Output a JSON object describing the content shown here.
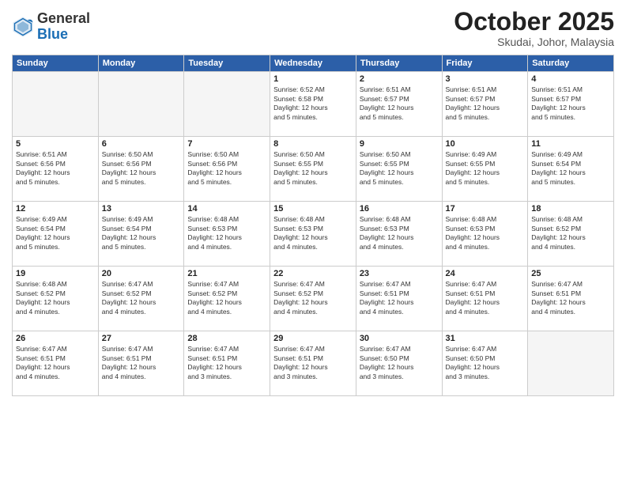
{
  "header": {
    "logo": {
      "general": "General",
      "blue": "Blue"
    },
    "title": "October 2025",
    "subtitle": "Skudai, Johor, Malaysia"
  },
  "calendar": {
    "weekdays": [
      "Sunday",
      "Monday",
      "Tuesday",
      "Wednesday",
      "Thursday",
      "Friday",
      "Saturday"
    ],
    "weeks": [
      [
        {
          "day": "",
          "details": ""
        },
        {
          "day": "",
          "details": ""
        },
        {
          "day": "",
          "details": ""
        },
        {
          "day": "1",
          "details": "Sunrise: 6:52 AM\nSunset: 6:58 PM\nDaylight: 12 hours\nand 5 minutes."
        },
        {
          "day": "2",
          "details": "Sunrise: 6:51 AM\nSunset: 6:57 PM\nDaylight: 12 hours\nand 5 minutes."
        },
        {
          "day": "3",
          "details": "Sunrise: 6:51 AM\nSunset: 6:57 PM\nDaylight: 12 hours\nand 5 minutes."
        },
        {
          "day": "4",
          "details": "Sunrise: 6:51 AM\nSunset: 6:57 PM\nDaylight: 12 hours\nand 5 minutes."
        }
      ],
      [
        {
          "day": "5",
          "details": "Sunrise: 6:51 AM\nSunset: 6:56 PM\nDaylight: 12 hours\nand 5 minutes."
        },
        {
          "day": "6",
          "details": "Sunrise: 6:50 AM\nSunset: 6:56 PM\nDaylight: 12 hours\nand 5 minutes."
        },
        {
          "day": "7",
          "details": "Sunrise: 6:50 AM\nSunset: 6:56 PM\nDaylight: 12 hours\nand 5 minutes."
        },
        {
          "day": "8",
          "details": "Sunrise: 6:50 AM\nSunset: 6:55 PM\nDaylight: 12 hours\nand 5 minutes."
        },
        {
          "day": "9",
          "details": "Sunrise: 6:50 AM\nSunset: 6:55 PM\nDaylight: 12 hours\nand 5 minutes."
        },
        {
          "day": "10",
          "details": "Sunrise: 6:49 AM\nSunset: 6:55 PM\nDaylight: 12 hours\nand 5 minutes."
        },
        {
          "day": "11",
          "details": "Sunrise: 6:49 AM\nSunset: 6:54 PM\nDaylight: 12 hours\nand 5 minutes."
        }
      ],
      [
        {
          "day": "12",
          "details": "Sunrise: 6:49 AM\nSunset: 6:54 PM\nDaylight: 12 hours\nand 5 minutes."
        },
        {
          "day": "13",
          "details": "Sunrise: 6:49 AM\nSunset: 6:54 PM\nDaylight: 12 hours\nand 5 minutes."
        },
        {
          "day": "14",
          "details": "Sunrise: 6:48 AM\nSunset: 6:53 PM\nDaylight: 12 hours\nand 4 minutes."
        },
        {
          "day": "15",
          "details": "Sunrise: 6:48 AM\nSunset: 6:53 PM\nDaylight: 12 hours\nand 4 minutes."
        },
        {
          "day": "16",
          "details": "Sunrise: 6:48 AM\nSunset: 6:53 PM\nDaylight: 12 hours\nand 4 minutes."
        },
        {
          "day": "17",
          "details": "Sunrise: 6:48 AM\nSunset: 6:53 PM\nDaylight: 12 hours\nand 4 minutes."
        },
        {
          "day": "18",
          "details": "Sunrise: 6:48 AM\nSunset: 6:52 PM\nDaylight: 12 hours\nand 4 minutes."
        }
      ],
      [
        {
          "day": "19",
          "details": "Sunrise: 6:48 AM\nSunset: 6:52 PM\nDaylight: 12 hours\nand 4 minutes."
        },
        {
          "day": "20",
          "details": "Sunrise: 6:47 AM\nSunset: 6:52 PM\nDaylight: 12 hours\nand 4 minutes."
        },
        {
          "day": "21",
          "details": "Sunrise: 6:47 AM\nSunset: 6:52 PM\nDaylight: 12 hours\nand 4 minutes."
        },
        {
          "day": "22",
          "details": "Sunrise: 6:47 AM\nSunset: 6:52 PM\nDaylight: 12 hours\nand 4 minutes."
        },
        {
          "day": "23",
          "details": "Sunrise: 6:47 AM\nSunset: 6:51 PM\nDaylight: 12 hours\nand 4 minutes."
        },
        {
          "day": "24",
          "details": "Sunrise: 6:47 AM\nSunset: 6:51 PM\nDaylight: 12 hours\nand 4 minutes."
        },
        {
          "day": "25",
          "details": "Sunrise: 6:47 AM\nSunset: 6:51 PM\nDaylight: 12 hours\nand 4 minutes."
        }
      ],
      [
        {
          "day": "26",
          "details": "Sunrise: 6:47 AM\nSunset: 6:51 PM\nDaylight: 12 hours\nand 4 minutes."
        },
        {
          "day": "27",
          "details": "Sunrise: 6:47 AM\nSunset: 6:51 PM\nDaylight: 12 hours\nand 4 minutes."
        },
        {
          "day": "28",
          "details": "Sunrise: 6:47 AM\nSunset: 6:51 PM\nDaylight: 12 hours\nand 3 minutes."
        },
        {
          "day": "29",
          "details": "Sunrise: 6:47 AM\nSunset: 6:51 PM\nDaylight: 12 hours\nand 3 minutes."
        },
        {
          "day": "30",
          "details": "Sunrise: 6:47 AM\nSunset: 6:50 PM\nDaylight: 12 hours\nand 3 minutes."
        },
        {
          "day": "31",
          "details": "Sunrise: 6:47 AM\nSunset: 6:50 PM\nDaylight: 12 hours\nand 3 minutes."
        },
        {
          "day": "",
          "details": ""
        }
      ]
    ]
  }
}
